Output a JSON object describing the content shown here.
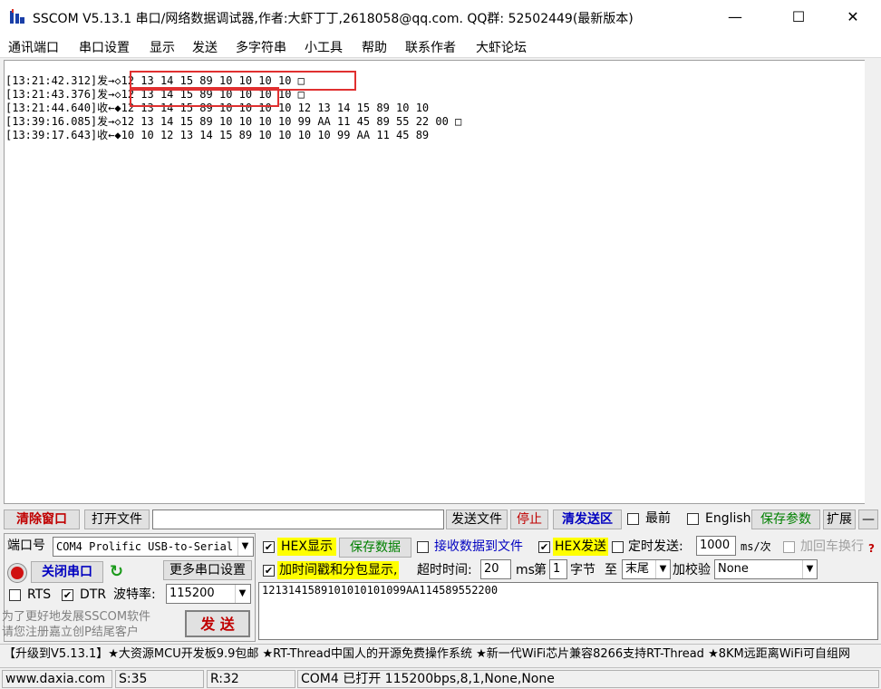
{
  "window": {
    "title": "SSCOM V5.13.1 串口/网络数据调试器,作者:大虾丁丁,2618058@qq.com. QQ群:  52502449(最新版本)",
    "minimize": "—",
    "maximize": "☐",
    "close": "✕"
  },
  "menu": [
    "通讯端口",
    "串口设置",
    "显示",
    "发送",
    "多字符串",
    "小工具",
    "帮助",
    "联系作者",
    "大虾论坛"
  ],
  "log": [
    "[13:21:42.312]发→◇12 13 14 15 89 10 10 10 10 □",
    "[13:21:43.376]发→◇12 13 14 15 89 10 10 10 10 □",
    "[13:21:44.640]收←◆12 13 14 15 89 10 10 10 10 12 13 14 15 89 10 10",
    "[13:39:16.085]发→◇12 13 14 15 89 10 10 10 10 99 AA 11 45 89 55 22 00 □",
    "[13:39:17.643]收←◆10 10 12 13 14 15 89 10 10 10 10 99 AA 11 45 89"
  ],
  "toolbar": {
    "clear": "清除窗口",
    "open_file": "打开文件",
    "file_path": "",
    "send_file": "发送文件",
    "stop": "停止",
    "clear_send": "清发送区",
    "topmost": "最前",
    "english": "English",
    "save_params": "保存参数",
    "expand": "扩展",
    "collapse": "—"
  },
  "port": {
    "label": "端口号",
    "value": "COM4 Prolific USB-to-Serial",
    "close_port": "关闭串口",
    "more_settings": "更多串口设置",
    "rts": "RTS",
    "dtr": "DTR",
    "baud_label": "波特率:",
    "baud": "115200",
    "promo1": "为了更好地发展SSCOM软件",
    "promo2": "请您注册嘉立创P结尾客户"
  },
  "options": {
    "hex_display": "HEX显示",
    "save_data": "保存数据",
    "recv_to_file": "接收数据到文件",
    "hex_send": "HEX发送",
    "timed_send": "定时发送:",
    "interval": "1000",
    "interval_unit": "ms/次",
    "add_crlf": "加回车换行",
    "timestamp": "加时间戳和分包显示,",
    "timeout_label": "超时时间:",
    "timeout": "20",
    "timeout_unit": "ms",
    "byte_label_1": "第",
    "byte_index": "1",
    "byte_label_2": "字节",
    "to_label": "至",
    "to_value": "末尾",
    "checksum_label": "加校验",
    "checksum": "None",
    "help": "?"
  },
  "send": {
    "text": "1213141589101010101099AA114589552200",
    "button": "发  送"
  },
  "ticker": "【升级到V5.13.1】★大资源MCU开发板9.9包邮 ★RT-Thread中国人的开源免费操作系统 ★新一代WiFi芯片兼容8266支持RT-Thread ★8KM远距离WiFi可自组网",
  "status": {
    "website": "www.daxia.com",
    "sent": "S:35",
    "received": "R:32",
    "port_info": "COM4 已打开  115200bps,8,1,None,None"
  }
}
